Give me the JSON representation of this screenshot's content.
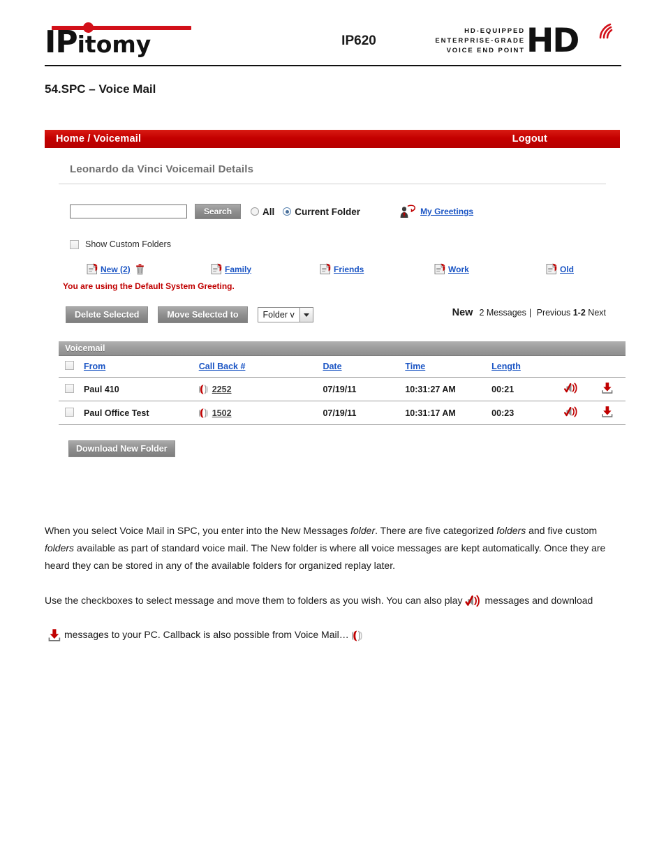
{
  "document": {
    "brand": "IPitomy",
    "brand_part1": "IP",
    "brand_part2": "itomy",
    "model": "IP620",
    "hd_tagline_line1": "HD-EQUIPPED",
    "hd_tagline_line2": "ENTERPRISE-GRADE",
    "hd_tagline_line3": "VOICE END POINT",
    "hd_logo_text": "HD",
    "section_title": "54.SPC – Voice Mail"
  },
  "app": {
    "breadcrumb": "Home / Voicemail",
    "logout_label": "Logout",
    "panel_title": "Leonardo da Vinci Voicemail Details",
    "search": {
      "value": "",
      "placeholder": "",
      "button_label": "Search",
      "scope_all_label": "All",
      "scope_current_label": "Current Folder",
      "scope_selected": "Current Folder"
    },
    "greetings_link": "My Greetings",
    "show_custom_folders_label": "Show Custom Folders",
    "show_custom_folders_checked": false,
    "folders": [
      {
        "label": "New (2)",
        "has_trash": true
      },
      {
        "label": "Family",
        "has_trash": false
      },
      {
        "label": "Friends",
        "has_trash": false
      },
      {
        "label": "Work",
        "has_trash": false
      },
      {
        "label": "Old",
        "has_trash": false
      }
    ],
    "greeting_note": "You are using the Default System Greeting.",
    "actions": {
      "delete_selected_label": "Delete Selected",
      "move_selected_label": "Move Selected to",
      "folder_select_value": "Folder v",
      "download_new_folder_label": "Download New Folder"
    },
    "pager": {
      "folder_name": "New",
      "count_text": "2 Messages",
      "separator": "|",
      "previous_label": "Previous",
      "range": "1-2",
      "next_label": "Next"
    },
    "table": {
      "caption": "Voicemail",
      "columns": [
        "From",
        "Call Back #",
        "Date",
        "Time",
        "Length"
      ],
      "rows": [
        {
          "checked": false,
          "from": "Paul 410",
          "callback": "2252",
          "date": "07/19/11",
          "time": "10:31:27 AM",
          "length": "00:21"
        },
        {
          "checked": false,
          "from": "Paul Office Test",
          "callback": "1502",
          "date": "07/19/11",
          "time": "10:31:17 AM",
          "length": "00:23"
        }
      ]
    }
  },
  "body_copy": {
    "p1_a": "When you select Voice Mail in SPC, you enter into the New Messages ",
    "p1_i1": "folder",
    "p1_b": ". There are five categorized ",
    "p1_i2": "folders",
    "p1_c": " and five custom ",
    "p1_i3": "folders",
    "p1_d": " available as part of standard voice mail. The New folder is where all voice messages are kept automatically. Once they are heard they can be stored in any of the available folders for organized replay later.",
    "p2_a": "Use the checkboxes to select message and move them to folders as you wish. You can also play",
    "p2_b": "messages and download",
    "p2_c": "messages to your PC. Callback is also possible from Voice Mail…"
  },
  "colors": {
    "brand_red": "#c40000",
    "link_blue": "#1b55c4",
    "note_red": "#c00000",
    "button_gray": "#8f8f8f",
    "caption_gray": "#9d9d9d"
  },
  "icons": {
    "greetings": "person-speech-bubble-icon",
    "folder": "document-folder-icon",
    "trash": "trash-icon",
    "play": "speaker-play-icon",
    "download": "download-arrow-icon",
    "callback": "phone-callback-icon"
  }
}
